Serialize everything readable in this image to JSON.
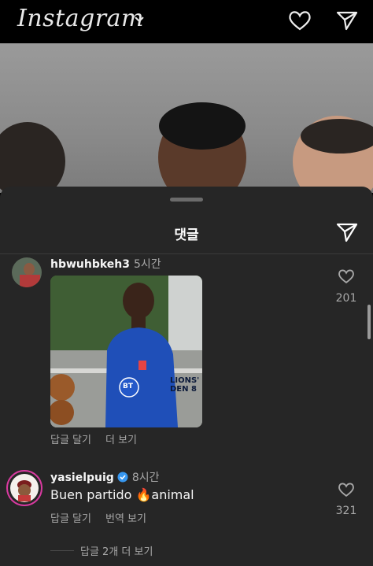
{
  "topbar": {
    "logo": "Instagram"
  },
  "sheet": {
    "title": "댓글"
  },
  "comments": [
    {
      "username": "hbwuhbkeh3",
      "time": "5시간",
      "actions": [
        "답글 달기",
        "더 보기"
      ],
      "likes": "201",
      "image_caption": "LIONS' DEN 8",
      "jersey_text": "BT"
    },
    {
      "username": "yasielpuig",
      "verified": true,
      "time": "8시간",
      "text": "Buen partido 🔥animal",
      "actions": [
        "답글 달기",
        "번역 보기"
      ],
      "likes": "321",
      "view_replies": "답글 2개 더 보기"
    }
  ],
  "colors": {
    "sheet_bg": "#262626",
    "verified": "#3797f0",
    "muted": "#a8a8a8"
  },
  "icons": [
    "heart-icon",
    "send-icon",
    "chevron-down-icon",
    "verified-badge-icon"
  ]
}
